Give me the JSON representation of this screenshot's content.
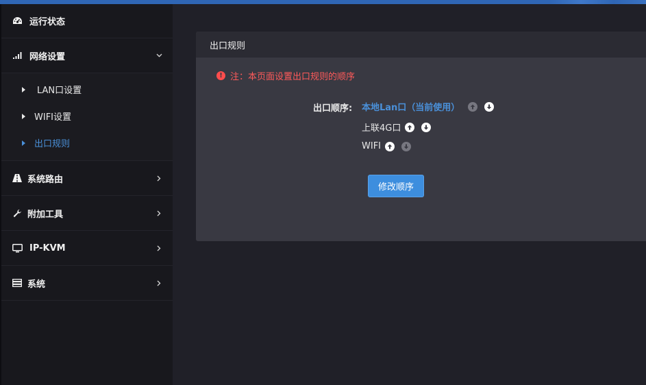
{
  "sidebar": {
    "items": [
      {
        "label": "运行状态",
        "icon": "dashboard-icon"
      },
      {
        "label": "网络设置",
        "icon": "signal-icon",
        "expanded": true,
        "children": [
          {
            "label": "LAN口设置"
          },
          {
            "label": "WIFI设置"
          },
          {
            "label": "出口规则",
            "active": true
          }
        ]
      },
      {
        "label": "系统路由",
        "icon": "road-icon"
      },
      {
        "label": "附加工具",
        "icon": "wrench-icon"
      },
      {
        "label": "IP-KVM",
        "icon": "monitor-icon"
      },
      {
        "label": "系统",
        "icon": "server-icon"
      }
    ]
  },
  "panel": {
    "title": "出口规则",
    "notice": "注：本页面设置出口规则的顺序",
    "order_label": "出口顺序:",
    "order": [
      {
        "name": "本地Lan口（当前使用）",
        "current": true,
        "up_enabled": false,
        "down_enabled": true
      },
      {
        "name": "上联4G口",
        "current": false,
        "up_enabled": true,
        "down_enabled": true
      },
      {
        "name": "WIFI",
        "current": false,
        "up_enabled": true,
        "down_enabled": false
      }
    ],
    "modify_button": "修改顺序"
  },
  "colors": {
    "accent": "#4a90d9",
    "warning": "#ff5a5a",
    "button": "#3d8ede"
  }
}
